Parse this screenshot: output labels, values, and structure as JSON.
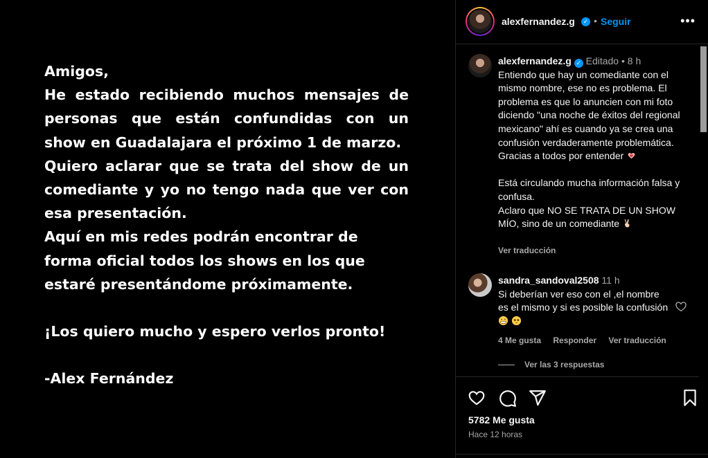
{
  "statement": {
    "greeting": "Amigos,",
    "paragraph1": "He estado recibiendo muchos mensajes de personas que están confundidas con un show en Guadalajara el próximo 1 de marzo.",
    "paragraph2": "Quiero aclarar que se trata del show de un comediante y yo no tengo nada que ver con esa presentación.",
    "paragraph3": "Aquí en mis redes podrán encontrar de forma oficial todos los shows en los que estaré presentándome próximamente.",
    "closing": "¡Los quiero mucho y espero verlos pronto!",
    "signature": "-Alex Fernández"
  },
  "header": {
    "username": "alexfernandez.g",
    "verified": "✓",
    "separator": "•",
    "follow_label": "Seguir",
    "more_icon": "•••"
  },
  "caption": {
    "username": "alexfernandez.g",
    "edited": "Editado",
    "time": "8 h",
    "text1": "Entiendo que hay un comediante con el mismo nombre, ese no es problema. El problema es que lo anuncien con mi foto diciendo \"una noche de éxitos del regional mexicano\" ahí es cuando ya se crea una confusión verdaderamente problemática. Gracias a todos por entender",
    "text2": "Está circulando mucha información falsa y confusa.",
    "text3": "Aclaro que NO SE TRATA DE UN SHOW MÍO, sino de un comediante",
    "see_translation": "Ver traducción"
  },
  "comment": {
    "username": "sandra_sandoval2508",
    "time": "11 h",
    "text": "Si deberían ver eso con el ,el nombre es el mismo y si es posible la confusión",
    "likes": "4 Me gusta",
    "reply": "Responder",
    "see_translation": "Ver traducción",
    "view_replies": "Ver las 3 respuestas"
  },
  "footer": {
    "likes": "5782 Me gusta",
    "time": "Hace 12 horas"
  },
  "icons": [
    "heart-icon",
    "comment-icon",
    "share-icon",
    "bookmark-icon",
    "more-icon",
    "verified-icon"
  ],
  "colors": {
    "accent": "#0095f6",
    "muted": "#a8a8a8",
    "background": "#000000",
    "border": "#262626"
  }
}
